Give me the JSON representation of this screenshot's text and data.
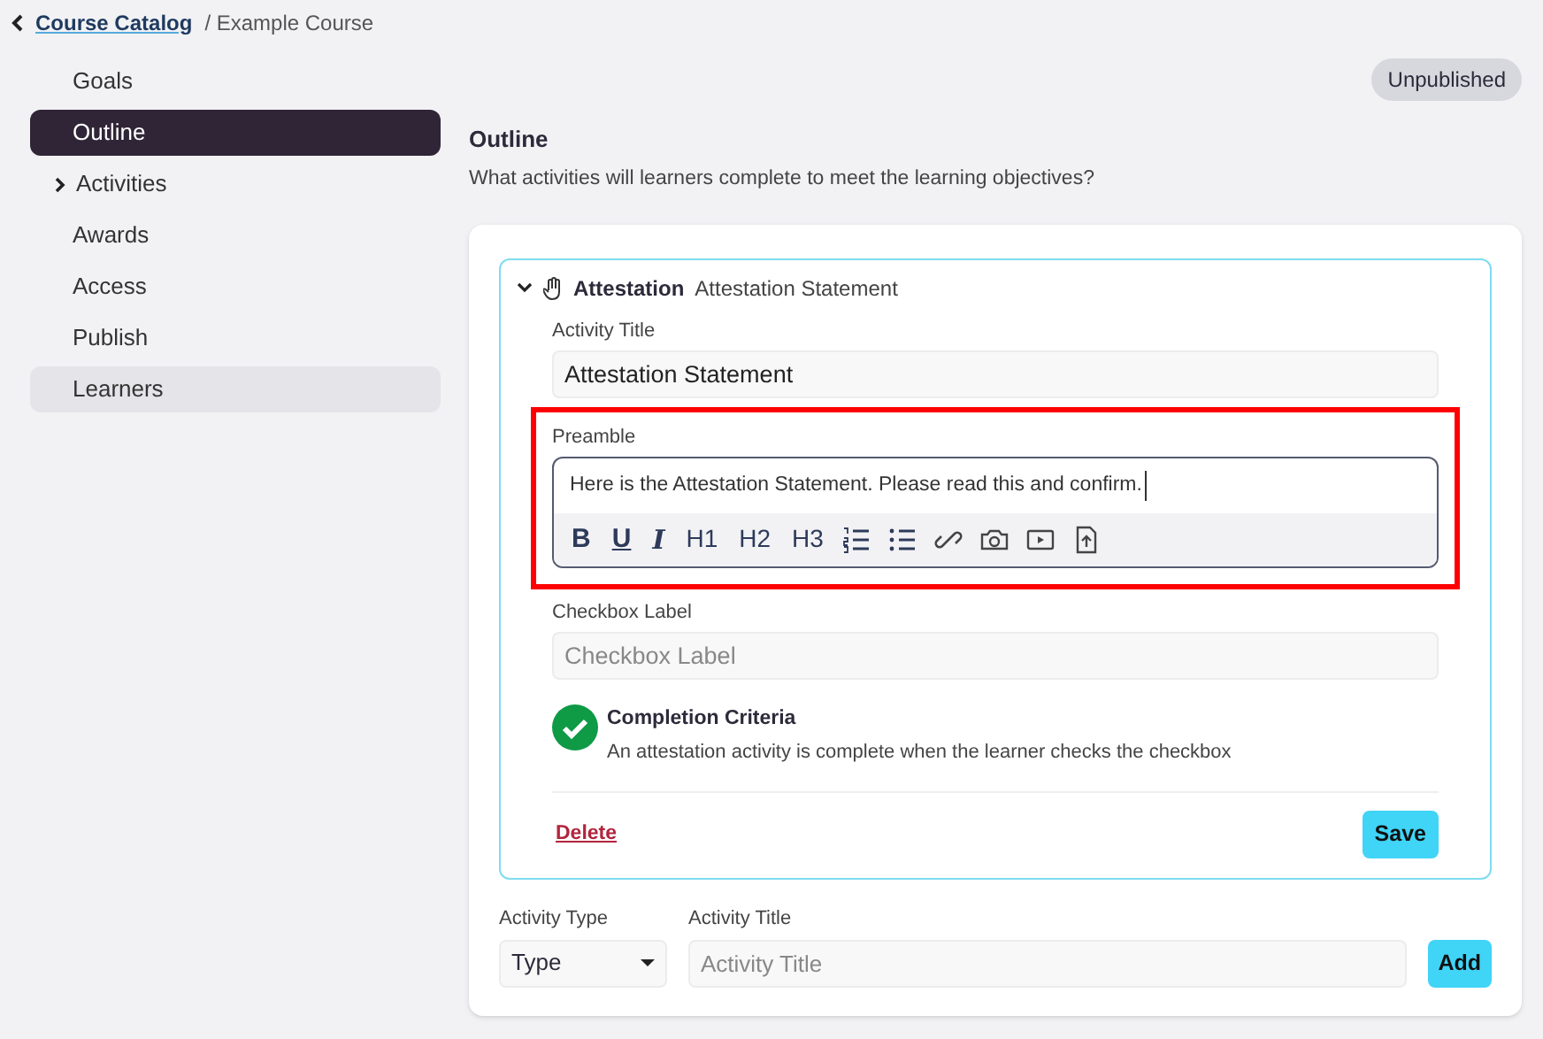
{
  "breadcrumb": {
    "link": "Course Catalog",
    "current": "/ Example Course"
  },
  "sidebar": {
    "items": [
      {
        "label": "Goals",
        "selected": false,
        "has_children": false,
        "highlighted": false
      },
      {
        "label": "Outline",
        "selected": true,
        "has_children": false,
        "highlighted": false
      },
      {
        "label": "Activities",
        "selected": false,
        "has_children": true,
        "highlighted": false
      },
      {
        "label": "Awards",
        "selected": false,
        "has_children": false,
        "highlighted": false
      },
      {
        "label": "Access",
        "selected": false,
        "has_children": false,
        "highlighted": false
      },
      {
        "label": "Publish",
        "selected": false,
        "has_children": false,
        "highlighted": false
      },
      {
        "label": "Learners",
        "selected": false,
        "has_children": false,
        "highlighted": true
      }
    ]
  },
  "status_badge": "Unpublished",
  "section": {
    "title": "Outline",
    "subtitle": "What activities will learners complete to meet the learning objectives?"
  },
  "activity": {
    "expanded": true,
    "type": "Attestation",
    "name": "Attestation Statement",
    "title_label": "Activity Title",
    "title_value": "Attestation Statement",
    "preamble_label": "Preamble",
    "preamble_text": "Here is the Attestation Statement. Please read this and confirm.",
    "toolbar": [
      {
        "kind": "bold",
        "label": "B"
      },
      {
        "kind": "underline",
        "label": "U"
      },
      {
        "kind": "italic",
        "label": "I"
      },
      {
        "kind": "heading",
        "label": "H1"
      },
      {
        "kind": "heading",
        "label": "H2"
      },
      {
        "kind": "heading",
        "label": "H3"
      },
      {
        "kind": "ordered-list"
      },
      {
        "kind": "bullet-list"
      },
      {
        "kind": "link"
      },
      {
        "kind": "camera"
      },
      {
        "kind": "video"
      },
      {
        "kind": "file-upload"
      }
    ],
    "checkbox_label": "Checkbox Label",
    "checkbox_placeholder": "Checkbox Label",
    "criteria_title": "Completion Criteria",
    "criteria_text": "An attestation activity is complete when the learner checks the checkbox",
    "delete": "Delete",
    "save": "Save"
  },
  "add_form": {
    "type_label": "Activity Type",
    "type_value": "Type",
    "title_label": "Activity Title",
    "title_placeholder": "Activity Title",
    "add": "Add"
  }
}
